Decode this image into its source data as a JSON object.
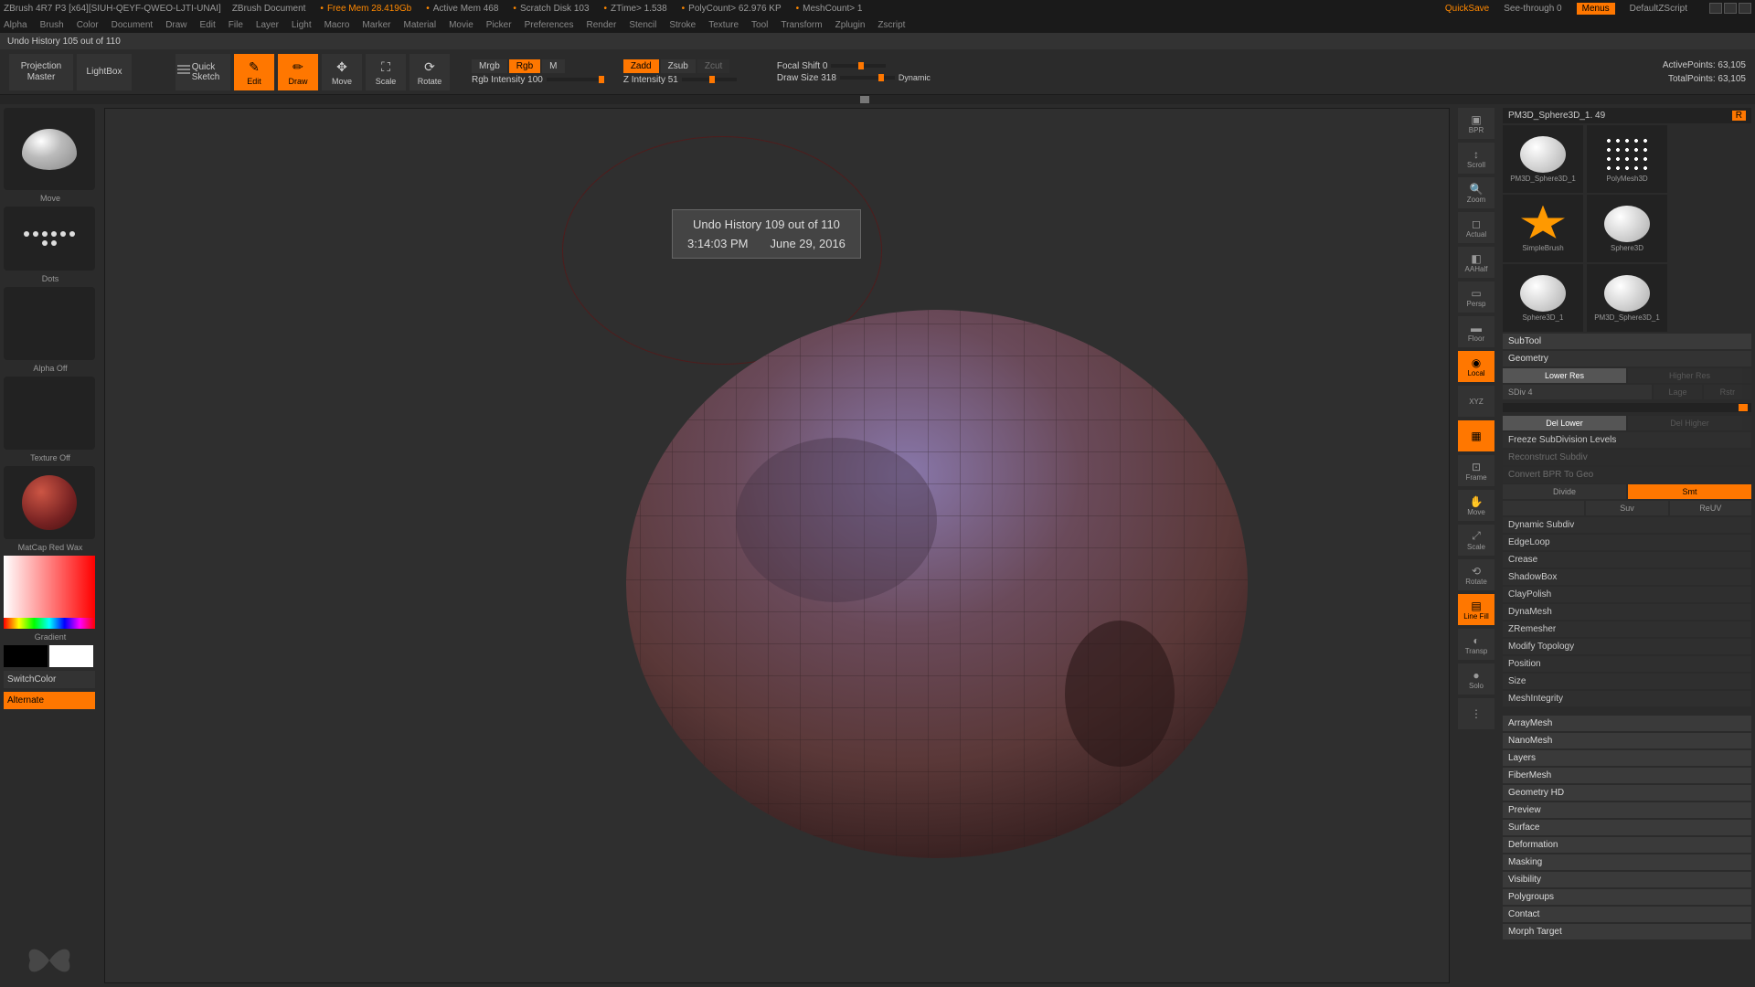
{
  "titlebar": {
    "app": "ZBrush 4R7 P3 [x64][SIUH-QEYF-QWEO-LJTI-UNAI]",
    "doc": "ZBrush Document",
    "freemem": "Free Mem 28.419Gb",
    "activemem": "Active Mem 468",
    "scratch": "Scratch Disk 103",
    "ztime": "ZTime> 1.538",
    "polycount": "PolyCount> 62.976 KP",
    "meshcount": "MeshCount> 1",
    "quicksave": "QuickSave",
    "seethrough": "See-through  0",
    "menus": "Menus",
    "script": "DefaultZScript"
  },
  "menu": [
    "Alpha",
    "Brush",
    "Color",
    "Document",
    "Draw",
    "Edit",
    "File",
    "Layer",
    "Light",
    "Macro",
    "Marker",
    "Material",
    "Movie",
    "Picker",
    "Preferences",
    "Render",
    "Stencil",
    "Stroke",
    "Texture",
    "Tool",
    "Transform",
    "Zplugin",
    "Zscript"
  ],
  "info": "Undo History 105 out of 110",
  "toolbar": {
    "proj": "Projection\nMaster",
    "lightbox": "LightBox",
    "quick": "Quick Sketch",
    "edit": "Edit",
    "draw": "Draw",
    "move": "Move",
    "scale": "Scale",
    "rotate": "Rotate",
    "mrgb": "Mrgb",
    "rgb": "Rgb",
    "m": "M",
    "rgbint": "Rgb Intensity 100",
    "zadd": "Zadd",
    "zsub": "Zsub",
    "zcut": "Zcut",
    "zint": "Z Intensity 51",
    "focal": "Focal Shift 0",
    "drawsize": "Draw Size 318",
    "dynamic": "Dynamic",
    "active": "ActivePoints: 63,105",
    "total": "TotalPoints: 63,105"
  },
  "tooltip": {
    "line1": "Undo History 109 out of 110",
    "time": "3:14:03 PM",
    "date": "June 29, 2016"
  },
  "left": {
    "brush": "Move",
    "stroke": "Dots",
    "alpha": "Alpha Off",
    "texture": "Texture Off",
    "material": "MatCap Red Wax",
    "gradient": "Gradient",
    "switch": "SwitchColor",
    "alternate": "Alternate"
  },
  "shelf": [
    "BPR",
    "Scroll",
    "Zoom",
    "Actual",
    "AAHalf",
    "Persp",
    "Floor",
    "Local",
    "XYZ",
    "Frame",
    "Move",
    "Scale",
    "Rotate",
    "Line Fill",
    "Transp",
    "Solo"
  ],
  "tool_title": "PM3D_Sphere3D_1. 49",
  "thumbs": [
    "PM3D_Sphere3D_1",
    "PolyMesh3D",
    "SimpleBrush",
    "Sphere3D",
    "Sphere3D_1",
    "PM3D_Sphere3D_1"
  ],
  "panels": {
    "subtool": "SubTool",
    "geometry": "Geometry",
    "lower": "Lower Res",
    "higher": "Higher Res",
    "sdiv": "SDiv 4",
    "dellower": "Del Lower",
    "delhigher": "Del Higher",
    "freeze": "Freeze SubDivision Levels",
    "reconstruct": "Reconstruct Subdiv",
    "convert": "Convert BPR To Geo",
    "divide": "Divide",
    "smt": "Smt",
    "suv": "Suv",
    "reuv": "ReUV",
    "dynamic": "Dynamic Subdiv",
    "edgeloop": "EdgeLoop",
    "crease": "Crease",
    "shadowbox": "ShadowBox",
    "claypolish": "ClayPolish",
    "dynamesh": "DynaMesh",
    "zremesher": "ZRemesher",
    "modtopo": "Modify Topology",
    "position": "Position",
    "size": "Size",
    "meshint": "MeshIntegrity",
    "arraymesh": "ArrayMesh",
    "nanomesh": "NanoMesh",
    "layers": "Layers",
    "fibermesh": "FiberMesh",
    "geohd": "Geometry HD",
    "preview": "Preview",
    "surface": "Surface",
    "deformation": "Deformation",
    "masking": "Masking",
    "visibility": "Visibility",
    "polygroups": "Polygroups",
    "contact": "Contact",
    "morph": "Morph Target"
  }
}
